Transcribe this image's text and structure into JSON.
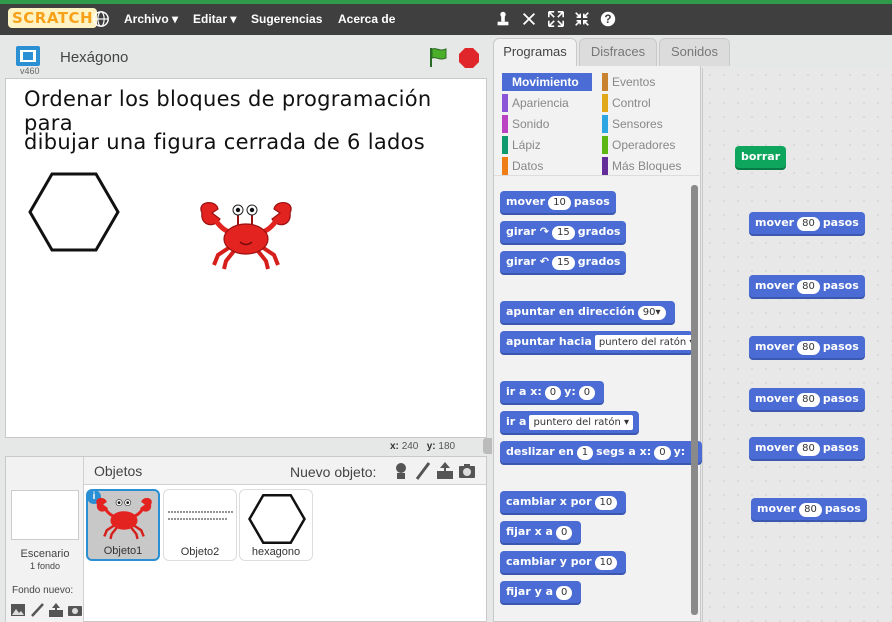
{
  "menubar": {
    "logo": "SCRATCH",
    "menus": [
      "Archivo ▾",
      "Editar ▾",
      "Sugerencias",
      "Acerca de"
    ]
  },
  "stage": {
    "version": "v460",
    "title": "Hexágono",
    "text_line_1": "Ordenar los bloques de programación para",
    "text_line_2": "dibujar una figura cerrada de 6 lados",
    "coords": {
      "x_label": "x:",
      "x": "240",
      "y_label": "y:",
      "y": "180"
    }
  },
  "sprites": {
    "header": "Objetos",
    "new_sprite": "Nuevo objeto:",
    "stage_name": "Escenario",
    "stage_backdrops": "1 fondo",
    "new_backdrop": "Fondo nuevo:",
    "items": [
      {
        "name": "Objeto1"
      },
      {
        "name": "Objeto2"
      },
      {
        "name": "hexagono"
      }
    ]
  },
  "tabs": [
    "Programas",
    "Disfraces",
    "Sonidos"
  ],
  "categories": [
    {
      "label": "Movimiento",
      "color": "#4a6cd4"
    },
    {
      "label": "Eventos",
      "color": "#c88330"
    },
    {
      "label": "Apariencia",
      "color": "#8a55d7"
    },
    {
      "label": "Control",
      "color": "#e1a91a"
    },
    {
      "label": "Sonido",
      "color": "#bb42c3"
    },
    {
      "label": "Sensores",
      "color": "#2ca5e2"
    },
    {
      "label": "Lápiz",
      "color": "#0e9a6c"
    },
    {
      "label": "Operadores",
      "color": "#5cb712"
    },
    {
      "label": "Datos",
      "color": "#ee7d16"
    },
    {
      "label": "Más Bloques",
      "color": "#632d99"
    }
  ],
  "palette_blocks": {
    "mover": {
      "a": "mover",
      "v": "10",
      "b": "pasos"
    },
    "girar_r": {
      "a": "girar",
      "v": "15",
      "b": "grados"
    },
    "girar_l": {
      "a": "girar",
      "v": "15",
      "b": "grados"
    },
    "apuntar_dir": {
      "a": "apuntar en dirección",
      "v": "90▾"
    },
    "apuntar_hacia": {
      "a": "apuntar hacia",
      "v": "puntero del ratón ▾"
    },
    "ir_xy": {
      "a": "ir a x:",
      "x": "0",
      "ylab": "y:",
      "y": "0"
    },
    "ir_a": {
      "a": "ir a",
      "v": "puntero del ratón ▾"
    },
    "deslizar": {
      "a": "deslizar en",
      "v": "1",
      "b": "segs a x:",
      "x": "0",
      "ylab": "y:"
    },
    "cambiar_x": {
      "a": "cambiar x por",
      "v": "10"
    },
    "fijar_x": {
      "a": "fijar x a",
      "v": "0"
    },
    "cambiar_y": {
      "a": "cambiar y por",
      "v": "10"
    },
    "fijar_y": {
      "a": "fijar y a",
      "v": "0"
    }
  },
  "script_blocks": {
    "borrar": "borrar",
    "mover_label": "mover",
    "mover_value": "80",
    "mover_unit": "pasos"
  }
}
